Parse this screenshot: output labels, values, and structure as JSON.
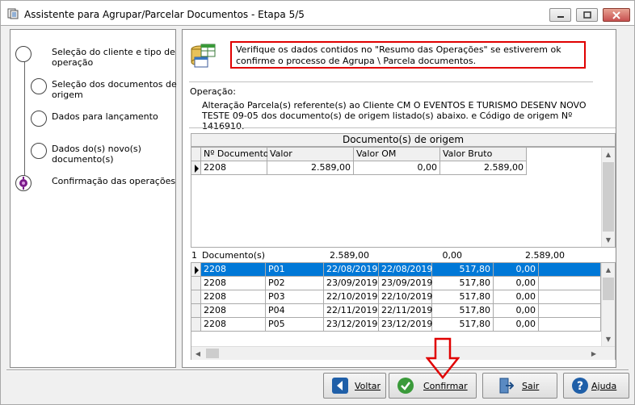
{
  "window": {
    "title": "Assistente para Agrupar/Parcelar Documentos - Etapa 5/5"
  },
  "steps": [
    {
      "label": "Seleção do cliente e tipo de\noperação",
      "active": false
    },
    {
      "label": "Seleção dos documentos de\norigem",
      "active": false
    },
    {
      "label": "Dados para lançamento",
      "active": false
    },
    {
      "label": "Dados do(s) novo(s)\ndocumento(s)",
      "active": false
    },
    {
      "label": "Confirmação das operações",
      "active": true
    }
  ],
  "notice": "Verifique os dados contidos no \"Resumo das Operações\" se estiverem ok confirme o processo de Agrupa \\ Parcela documentos.",
  "operation": {
    "label": "Operação:",
    "description": "Alteração Parcela(s) referente(s) ao Cliente CM  O EVENTOS E TURISMO DESENV NOVO TESTE 09-05 dos documento(s) de origem listado(s) abaixo. e Código de origem Nº 1416910."
  },
  "origin_grid": {
    "title": "Documento(s) de origem",
    "headers": [
      "Nº Documento",
      "Valor",
      "Valor OM",
      "Valor Bruto"
    ],
    "rows": [
      [
        "2208",
        "2.589,00",
        "0,00",
        "2.589,00"
      ]
    ],
    "summary": {
      "count": "1",
      "label": "Documento(s)",
      "valor": "2.589,00",
      "valor_om": "0,00",
      "valor_bruto": "2.589,00"
    }
  },
  "new_docs_grid": {
    "rows": [
      [
        "2208",
        "P01",
        "22/08/2019",
        "22/08/2019",
        "517,80",
        "0,00"
      ],
      [
        "2208",
        "P02",
        "23/09/2019",
        "23/09/2019",
        "517,80",
        "0,00"
      ],
      [
        "2208",
        "P03",
        "22/10/2019",
        "22/10/2019",
        "517,80",
        "0,00"
      ],
      [
        "2208",
        "P04",
        "22/11/2019",
        "22/11/2019",
        "517,80",
        "0,00"
      ],
      [
        "2208",
        "P05",
        "23/12/2019",
        "23/12/2019",
        "517,80",
        "0,00"
      ]
    ],
    "selected_row": 0
  },
  "buttons": {
    "voltar": {
      "label": "Voltar",
      "icon": "back-arrow-icon"
    },
    "confirmar": {
      "label": "Confirmar",
      "icon": "check-icon"
    },
    "sair": {
      "label": "Sair",
      "icon": "exit-door-icon"
    },
    "ajuda": {
      "label": "Ajuda",
      "icon": "help-icon"
    }
  },
  "colors": {
    "accent": "#0078d7",
    "notice_border": "#e00000",
    "step_active": "#7a1a8a",
    "button_icon_blue": "#1f5fa8",
    "button_icon_green": "#3a9a3a"
  }
}
